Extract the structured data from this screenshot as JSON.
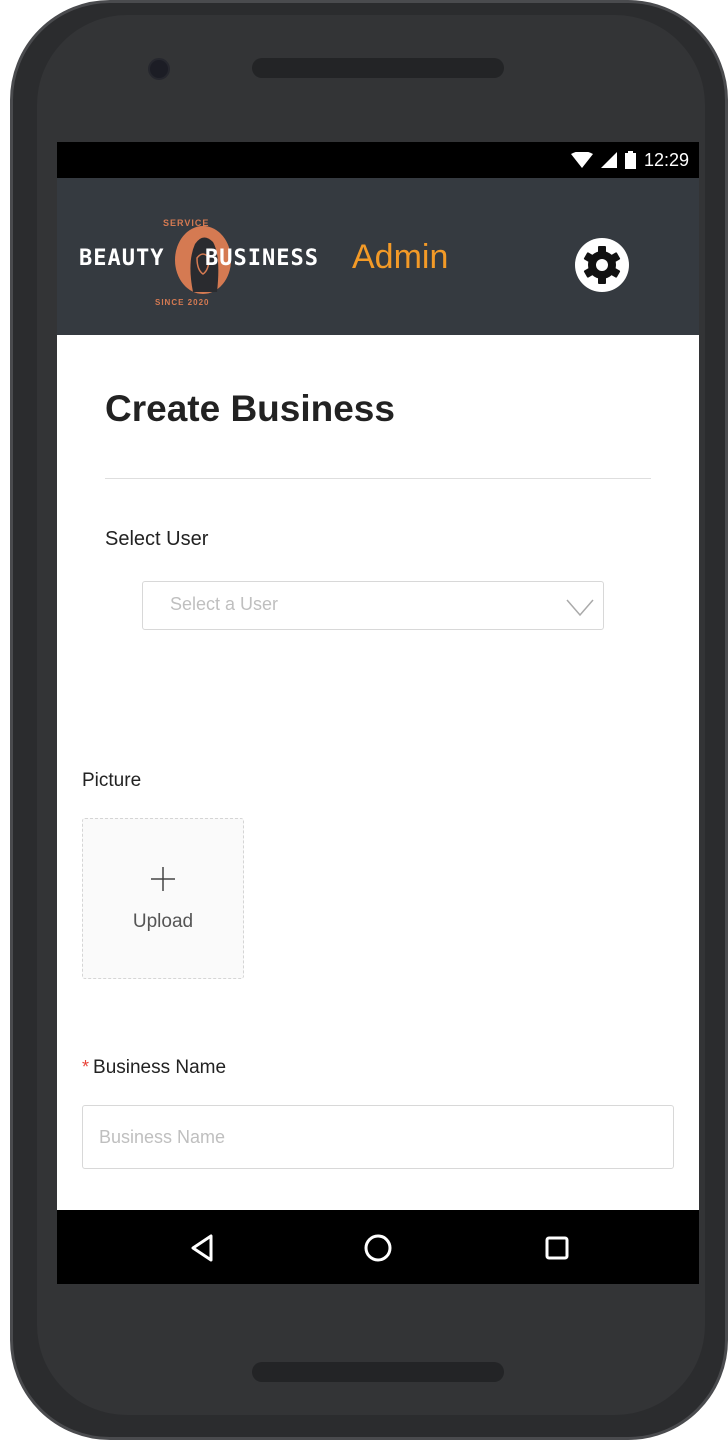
{
  "status_bar": {
    "time": "12:29",
    "icons": [
      "wifi-icon",
      "signal-icon",
      "battery-icon"
    ]
  },
  "header": {
    "logo": {
      "word_left": "BEAUTY",
      "word_right": "BUSINESS",
      "tagline_top": "SERVICE",
      "tagline_bottom": "SINCE 2020"
    },
    "title": "Admin",
    "settings_icon": "gear-icon",
    "colors": {
      "background": "#353a40",
      "title": "#f39a27",
      "logo_accent": "#d57a52"
    }
  },
  "form": {
    "title": "Create Business",
    "select_user": {
      "label": "Select User",
      "placeholder": "Select a User"
    },
    "picture": {
      "label": "Picture",
      "upload_label": "Upload"
    },
    "business_name": {
      "required_mark": "*",
      "label": "Business Name",
      "placeholder": "Business Name"
    }
  },
  "nav_bar": {
    "buttons": [
      "back-icon",
      "home-icon",
      "recents-icon"
    ]
  }
}
